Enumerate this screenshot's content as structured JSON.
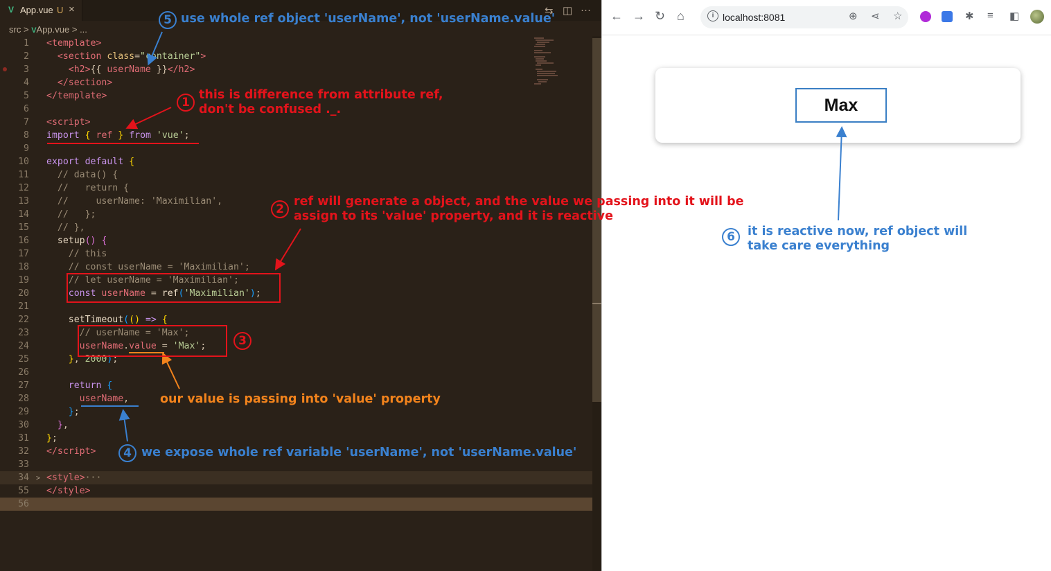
{
  "editor": {
    "tab": {
      "vue_icon": "V",
      "name": "App.vue",
      "modified": "U",
      "close": "×"
    },
    "breadcrumb": {
      "folder": "src",
      "sep": ">",
      "vue_icon": "V",
      "file": "App.vue",
      "more": "> ..."
    },
    "toolbar": {
      "compare_icon": "⇆",
      "split_icon": "◫",
      "more_icon": "···"
    },
    "lines": [
      {
        "n": "1",
        "html": "<span class='t-tag'>&lt;template&gt;</span>"
      },
      {
        "n": "2",
        "html": "  <span class='t-tag'>&lt;section</span> <span class='t-attr'>class</span>=<span class='t-str'>\"container\"</span><span class='t-tag'>&gt;</span>"
      },
      {
        "n": "3",
        "html": "    <span class='t-tag'>&lt;h2&gt;</span>{{ <span class='t-var'>userName</span> }}<span class='t-tag'>&lt;/h2&gt;</span>"
      },
      {
        "n": "4",
        "html": "  <span class='t-tag'>&lt;/section&gt;</span>"
      },
      {
        "n": "5",
        "html": "<span class='t-tag'>&lt;/template&gt;</span>"
      },
      {
        "n": "6",
        "html": ""
      },
      {
        "n": "7",
        "html": "<span class='t-tag'>&lt;script&gt;</span>"
      },
      {
        "n": "8",
        "html": "<span class='t-kw'>import</span> <span class='t-br'>{</span> <span class='t-var'>ref</span> <span class='t-br'>}</span> <span class='t-kw'>from</span> <span class='t-str'>'vue'</span>;"
      },
      {
        "n": "9",
        "html": ""
      },
      {
        "n": "10",
        "html": "<span class='t-kw'>export default</span> <span class='t-br'>{</span>"
      },
      {
        "n": "11",
        "html": "  <span class='t-cm'>// data() {</span>"
      },
      {
        "n": "12",
        "html": "  <span class='t-cm'>//   return {</span>"
      },
      {
        "n": "13",
        "html": "  <span class='t-cm'>//     userName: 'Maximilian',</span>"
      },
      {
        "n": "14",
        "html": "  <span class='t-cm'>//   };</span>"
      },
      {
        "n": "15",
        "html": "  <span class='t-cm'>// },</span>"
      },
      {
        "n": "16",
        "html": "  <span class='t-fn'>setup</span><span class='t-br2'>()</span> <span class='t-br2'>{</span>"
      },
      {
        "n": "17",
        "html": "    <span class='t-cm'>// this</span>"
      },
      {
        "n": "18",
        "html": "    <span class='t-cm'>// const userName = 'Maximilian';</span>"
      },
      {
        "n": "19",
        "html": "    <span class='t-cm'>// let userName = 'Maximilian';</span>"
      },
      {
        "n": "20",
        "html": "    <span class='t-kw'>const</span> <span class='t-var'>userName</span> = <span class='t-fn'>ref</span><span class='t-br3'>(</span><span class='t-str'>'Maximilian'</span><span class='t-br3'>)</span>;"
      },
      {
        "n": "21",
        "html": ""
      },
      {
        "n": "22",
        "html": "    <span class='t-fn'>setTimeout</span><span class='t-br3'>(</span><span class='t-br'>()</span> <span class='t-kw'>=&gt;</span> <span class='t-br'>{</span>"
      },
      {
        "n": "23",
        "html": "      <span class='t-cm'>// userName = 'Max';</span>"
      },
      {
        "n": "24",
        "html": "      <span class='t-var'>userName</span>.<span class='t-var'>value</span> = <span class='t-str'>'Max'</span>;"
      },
      {
        "n": "25",
        "html": "    <span class='t-br'>}</span>, <span class='t-str'>2000</span><span class='t-br3'>)</span>;"
      },
      {
        "n": "26",
        "html": ""
      },
      {
        "n": "27",
        "html": "    <span class='t-kw'>return</span> <span class='t-br3'>{</span>"
      },
      {
        "n": "28",
        "html": "      <span class='t-var'>userName</span>,"
      },
      {
        "n": "29",
        "html": "    <span class='t-br3'>}</span>;"
      },
      {
        "n": "30",
        "html": "  <span class='t-br2'>}</span>,"
      },
      {
        "n": "31",
        "html": "<span class='t-br'>}</span>;"
      },
      {
        "n": "32",
        "html": "<span class='t-tag'>&lt;/script&gt;</span>"
      },
      {
        "n": "33",
        "html": ""
      },
      {
        "n": "34",
        "html": "<span class='t-tag'>&lt;style&gt;</span><span class='t-cm'>···</span>"
      },
      {
        "n": "55",
        "html": "<span class='t-tag'>&lt;/style&gt;</span>"
      },
      {
        "n": "56",
        "html": ""
      }
    ]
  },
  "browser": {
    "nav": {
      "back": "←",
      "forward": "→",
      "reload": "↻",
      "home": "⌂"
    },
    "url": "localhost:8081",
    "info_icon": "i",
    "icons": {
      "zoom": "⊕",
      "share": "⋖",
      "star": "☆",
      "puzzle": "✱",
      "list": "≡",
      "sidepanel": "◧"
    },
    "page": {
      "user_name": "Max"
    }
  },
  "annotations": {
    "a1": {
      "num": "1",
      "text": "this is difference from attribute ref,\ndon't be confused ._."
    },
    "a2": {
      "num": "2",
      "text": "ref will generate a object, and the value we passing into it will be\nassign to its 'value' property, and it is reactive"
    },
    "a3": {
      "num": "3"
    },
    "a4": {
      "num": "4",
      "text": "we expose whole ref variable 'userName', not 'userName.value'"
    },
    "a5": {
      "num": "5",
      "text": "use whole ref object 'userName', not 'userName.value'"
    },
    "a6": {
      "num": "6",
      "text": "it is reactive now, ref object will\ntake care everything"
    },
    "orange": {
      "text": "our value is passing into 'value' property"
    }
  }
}
